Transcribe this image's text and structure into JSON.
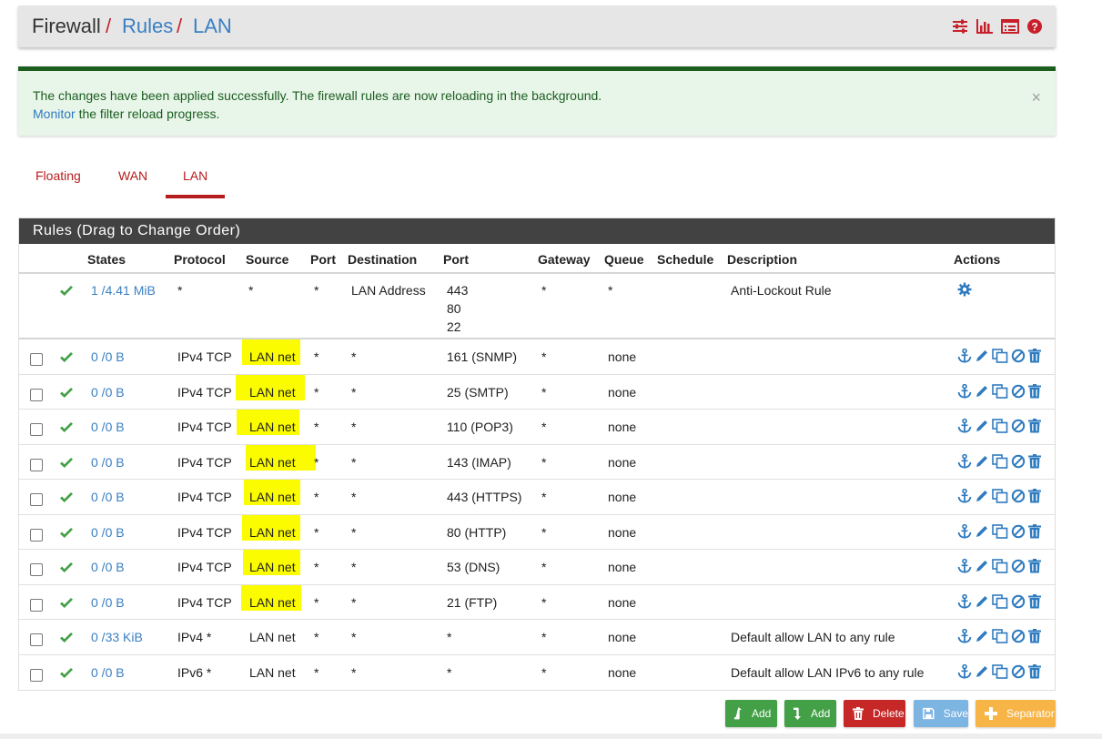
{
  "breadcrumb": {
    "root": "Firewall",
    "sep": "/",
    "level1": "Rules",
    "level2": "LAN"
  },
  "header_icons": [
    "sliders-icon",
    "bar-chart-icon",
    "list-table-icon",
    "help-icon"
  ],
  "alert": {
    "line1": "The changes have been applied successfully. The firewall rules are now reloading in the background.",
    "link": "Monitor",
    "line2_rest": " the filter reload progress.",
    "close": "×"
  },
  "tabs": [
    {
      "label": "Floating",
      "active": false
    },
    {
      "label": "WAN",
      "active": false
    },
    {
      "label": "LAN",
      "active": true
    }
  ],
  "panel": {
    "title": "Rules (Drag to Change Order)",
    "columns": [
      "States",
      "Protocol",
      "Source",
      "Port",
      "Destination",
      "Port",
      "Gateway",
      "Queue",
      "Schedule",
      "Description",
      "Actions"
    ]
  },
  "rules": [
    {
      "states": "1 /4.41 MiB",
      "protocol": "*",
      "source": "*",
      "sport": "*",
      "destination": "LAN Address",
      "dport": [
        "443",
        "80",
        "22"
      ],
      "gateway": "*",
      "queue": "*",
      "schedule": "",
      "description": "Anti-Lockout Rule",
      "locked": true,
      "highlight": false
    },
    {
      "states": "0 /0 B",
      "protocol": "IPv4 TCP",
      "source": "LAN net",
      "sport": "*",
      "destination": "*",
      "dport": [
        "161 (SNMP)"
      ],
      "gateway": "*",
      "queue": "none",
      "schedule": "",
      "description": "",
      "locked": false,
      "highlight": true
    },
    {
      "states": "0 /0 B",
      "protocol": "IPv4 TCP",
      "source": "LAN net",
      "sport": "*",
      "destination": "*",
      "dport": [
        "25 (SMTP)"
      ],
      "gateway": "*",
      "queue": "none",
      "schedule": "",
      "description": "",
      "locked": false,
      "highlight": true
    },
    {
      "states": "0 /0 B",
      "protocol": "IPv4 TCP",
      "source": "LAN net",
      "sport": "*",
      "destination": "*",
      "dport": [
        "110 (POP3)"
      ],
      "gateway": "*",
      "queue": "none",
      "schedule": "",
      "description": "",
      "locked": false,
      "highlight": true
    },
    {
      "states": "0 /0 B",
      "protocol": "IPv4 TCP",
      "source": "LAN net",
      "sport": "*",
      "destination": "*",
      "dport": [
        "143 (IMAP)"
      ],
      "gateway": "*",
      "queue": "none",
      "schedule": "",
      "description": "",
      "locked": false,
      "highlight": true
    },
    {
      "states": "0 /0 B",
      "protocol": "IPv4 TCP",
      "source": "LAN net",
      "sport": "*",
      "destination": "*",
      "dport": [
        "443 (HTTPS)"
      ],
      "gateway": "*",
      "queue": "none",
      "schedule": "",
      "description": "",
      "locked": false,
      "highlight": true
    },
    {
      "states": "0 /0 B",
      "protocol": "IPv4 TCP",
      "source": "LAN net",
      "sport": "*",
      "destination": "*",
      "dport": [
        "80 (HTTP)"
      ],
      "gateway": "*",
      "queue": "none",
      "schedule": "",
      "description": "",
      "locked": false,
      "highlight": true
    },
    {
      "states": "0 /0 B",
      "protocol": "IPv4 TCP",
      "source": "LAN net",
      "sport": "*",
      "destination": "*",
      "dport": [
        "53 (DNS)"
      ],
      "gateway": "*",
      "queue": "none",
      "schedule": "",
      "description": "",
      "locked": false,
      "highlight": true
    },
    {
      "states": "0 /0 B",
      "protocol": "IPv4 TCP",
      "source": "LAN net",
      "sport": "*",
      "destination": "*",
      "dport": [
        "21 (FTP)"
      ],
      "gateway": "*",
      "queue": "none",
      "schedule": "",
      "description": "",
      "locked": false,
      "highlight": true
    },
    {
      "states": "0 /33 KiB",
      "protocol": "IPv4 *",
      "source": "LAN net",
      "sport": "*",
      "destination": "*",
      "dport": [
        "*"
      ],
      "gateway": "*",
      "queue": "none",
      "schedule": "",
      "description": "Default allow LAN to any rule",
      "locked": false,
      "highlight": false
    },
    {
      "states": "0 /0 B",
      "protocol": "IPv6 *",
      "source": "LAN net",
      "sport": "*",
      "destination": "*",
      "dport": [
        "*"
      ],
      "gateway": "*",
      "queue": "none",
      "schedule": "",
      "description": "Default allow LAN IPv6 to any rule",
      "locked": false,
      "highlight": false
    }
  ],
  "row_icons": [
    "anchor-icon",
    "pencil-icon",
    "copy-icon",
    "disable-icon",
    "trash-icon"
  ],
  "buttons": {
    "add_top": "Add",
    "add_bottom": "Add",
    "delete": "Delete",
    "save": "Save",
    "separator": "Separator"
  },
  "colors": {
    "accent_red": "#b71c1c",
    "link_blue": "#3a7fc2",
    "success_green": "#43a047",
    "highlight_yellow": "#fcfc00"
  }
}
